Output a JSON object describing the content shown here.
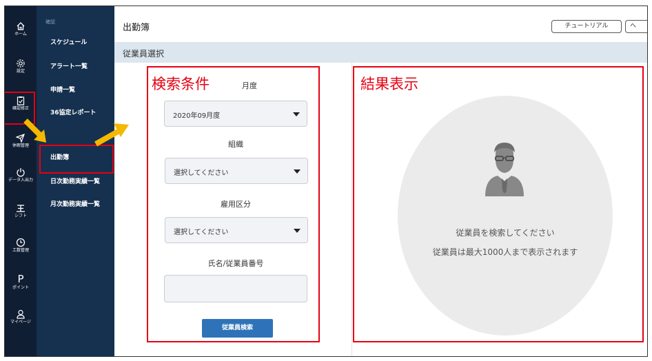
{
  "iconbar": {
    "items": [
      {
        "label": "ホーム",
        "icon": "home-icon"
      },
      {
        "label": "設定",
        "icon": "gear-icon"
      },
      {
        "label": "確認修正",
        "icon": "clipboard-check-icon"
      },
      {
        "label": "休暇管理",
        "icon": "airplane-icon"
      },
      {
        "label": "データ入出力",
        "icon": "power-icon"
      },
      {
        "label": "シフト",
        "icon": "shift-icon"
      },
      {
        "label": "工数管理",
        "icon": "clock-icon"
      },
      {
        "label": "ポイント",
        "icon": "point-p-icon"
      },
      {
        "label": "マイページ",
        "icon": "person-icon"
      }
    ]
  },
  "submenu": {
    "category": "確認",
    "items": [
      "スケジュール",
      "アラート一覧",
      "申請一覧",
      "36協定レポート",
      "出勤簿",
      "日次勤務実績一覧",
      "月次勤務実績一覧"
    ],
    "active": "出勤簿"
  },
  "header": {
    "title": "出勤簿",
    "tutorial_label": "チュートリアル",
    "help_label": "ヘ"
  },
  "section": {
    "title": "従業員選択"
  },
  "search_panel": {
    "annotation": "検索条件",
    "month_label": "月度",
    "month_value": "2020年09月度",
    "org_label": "組織",
    "org_value": "選択してください",
    "employment_label": "雇用区分",
    "employment_value": "選択してください",
    "name_label": "氏名/従業員番号",
    "name_value": "",
    "search_button": "従業員検索"
  },
  "result_panel": {
    "annotation": "結果表示",
    "message1": "従業員を検索してください",
    "message2": "従業員は最大1000人まで表示されます"
  },
  "colors": {
    "iconbar_bg": "#101e33",
    "submenu_bg": "#16304f",
    "accent_blue": "#2e73b8",
    "annotation_red": "#e60012",
    "arrow_yellow": "#f5b800"
  }
}
